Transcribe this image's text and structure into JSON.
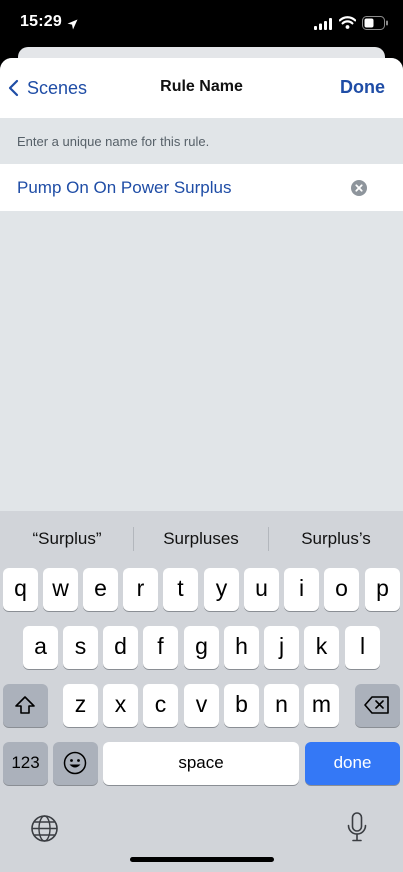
{
  "status": {
    "time": "15:29"
  },
  "nav": {
    "back_label": "Scenes",
    "title": "Rule Name",
    "done_label": "Done"
  },
  "form": {
    "hint": "Enter a unique name for this rule.",
    "value": "Pump On On Power Surplus"
  },
  "keyboard": {
    "suggestions": [
      "“Surplus”",
      "Surpluses",
      "Surplus’s"
    ],
    "row1": [
      "q",
      "w",
      "e",
      "r",
      "t",
      "y",
      "u",
      "i",
      "o",
      "p"
    ],
    "row2": [
      "a",
      "s",
      "d",
      "f",
      "g",
      "h",
      "j",
      "k",
      "l"
    ],
    "row3": [
      "z",
      "x",
      "c",
      "v",
      "b",
      "n",
      "m"
    ],
    "numbers_label": "123",
    "space_label": "space",
    "return_label": "done",
    "return_color": "#3478f6"
  },
  "icons": [
    "location-arrow-icon",
    "signal-icon",
    "wifi-icon",
    "battery-icon",
    "chevron-left-icon",
    "clear-icon",
    "shift-icon",
    "backspace-icon",
    "emoji-icon",
    "globe-icon",
    "microphone-icon"
  ]
}
